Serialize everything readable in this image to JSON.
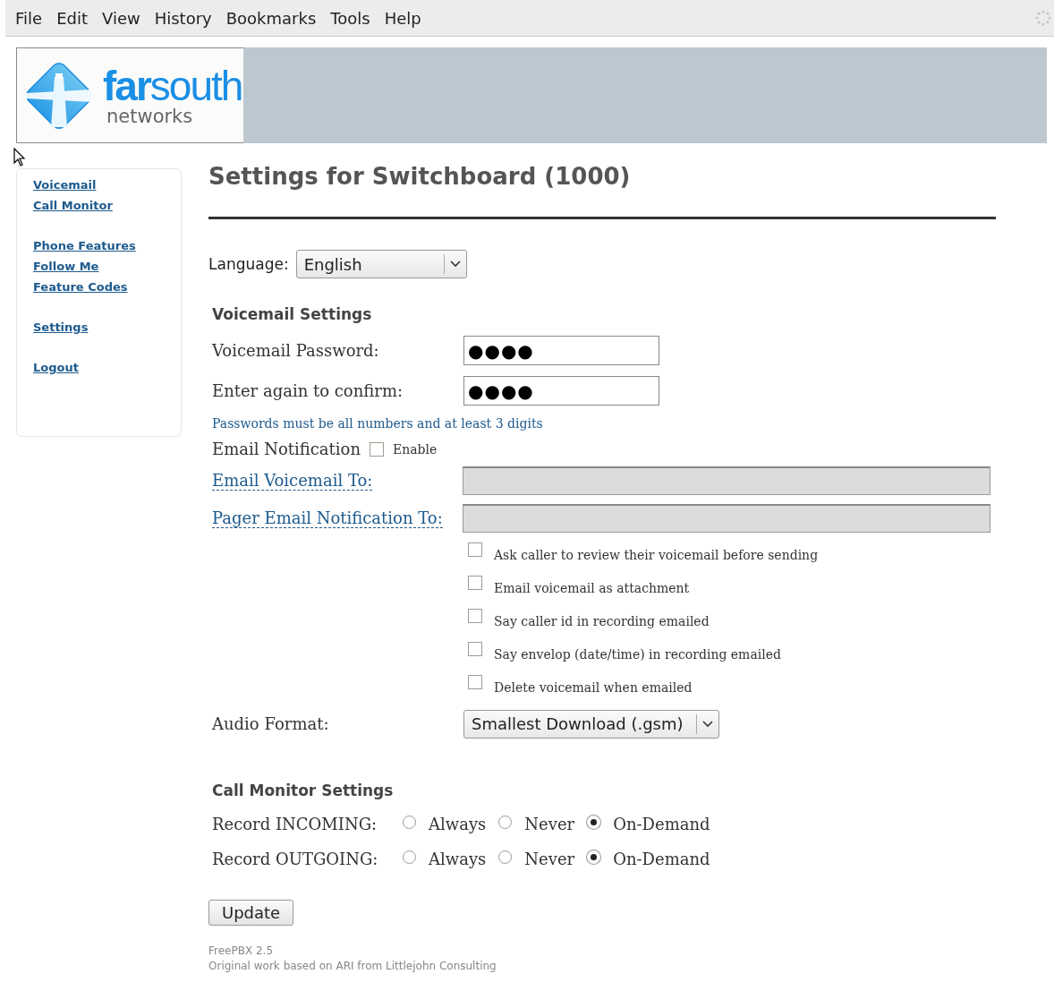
{
  "menu_bar": {
    "items": [
      "File",
      "Edit",
      "View",
      "History",
      "Bookmarks",
      "Tools",
      "Help"
    ]
  },
  "banner": {
    "logo_wordmark_bold": "far",
    "logo_wordmark_rest": "south",
    "logo_subtitle": "networks"
  },
  "sidebar": {
    "groups": [
      [
        "Voicemail",
        "Call Monitor"
      ],
      [
        "Phone Features",
        "Follow Me",
        "Feature Codes"
      ],
      [
        "Settings"
      ],
      [
        "Logout"
      ]
    ]
  },
  "page_title": "Settings for Switchboard (1000)",
  "language": {
    "label": "Language:",
    "value": "English"
  },
  "voicemail_settings": {
    "heading": "Voicemail Settings",
    "password": {
      "label": "Voicemail Password:",
      "value": "●●●●"
    },
    "confirm": {
      "label": "Enter again to confirm:",
      "value": "●●●●"
    },
    "hint": "Passwords must be all numbers and at least 3 digits",
    "email_notification": {
      "label": "Email Notification",
      "option": "Enable",
      "checked": false
    },
    "email_to": {
      "label": "Email Voicemail To:",
      "disabled": true
    },
    "pager_to": {
      "label": "Pager Email Notification To:",
      "disabled": true
    },
    "options": [
      {
        "label": "Ask caller to review their voicemail before sending",
        "checked": false
      },
      {
        "label": "Email voicemail as attachment",
        "checked": false
      },
      {
        "label": "Say caller id in recording emailed",
        "checked": false
      },
      {
        "label": "Say envelop (date/time) in recording emailed",
        "checked": false
      },
      {
        "label": "Delete voicemail when emailed",
        "checked": false
      }
    ],
    "audio_format": {
      "label": "Audio Format:",
      "value": "Smallest Download (.gsm)"
    }
  },
  "call_monitor_settings": {
    "heading": "Call Monitor Settings",
    "rows": [
      {
        "label": "Record INCOMING:",
        "choices": [
          {
            "label": "Always",
            "selected": false
          },
          {
            "label": "Never",
            "selected": false
          },
          {
            "label": "On-Demand",
            "selected": true
          }
        ]
      },
      {
        "label": "Record OUTGOING:",
        "choices": [
          {
            "label": "Always",
            "selected": false
          },
          {
            "label": "Never",
            "selected": false
          },
          {
            "label": "On-Demand",
            "selected": true
          }
        ]
      }
    ]
  },
  "update_button": "Update",
  "footer": [
    "FreePBX 2.5",
    "Original work based on ARI from Littlejohn Consulting"
  ]
}
